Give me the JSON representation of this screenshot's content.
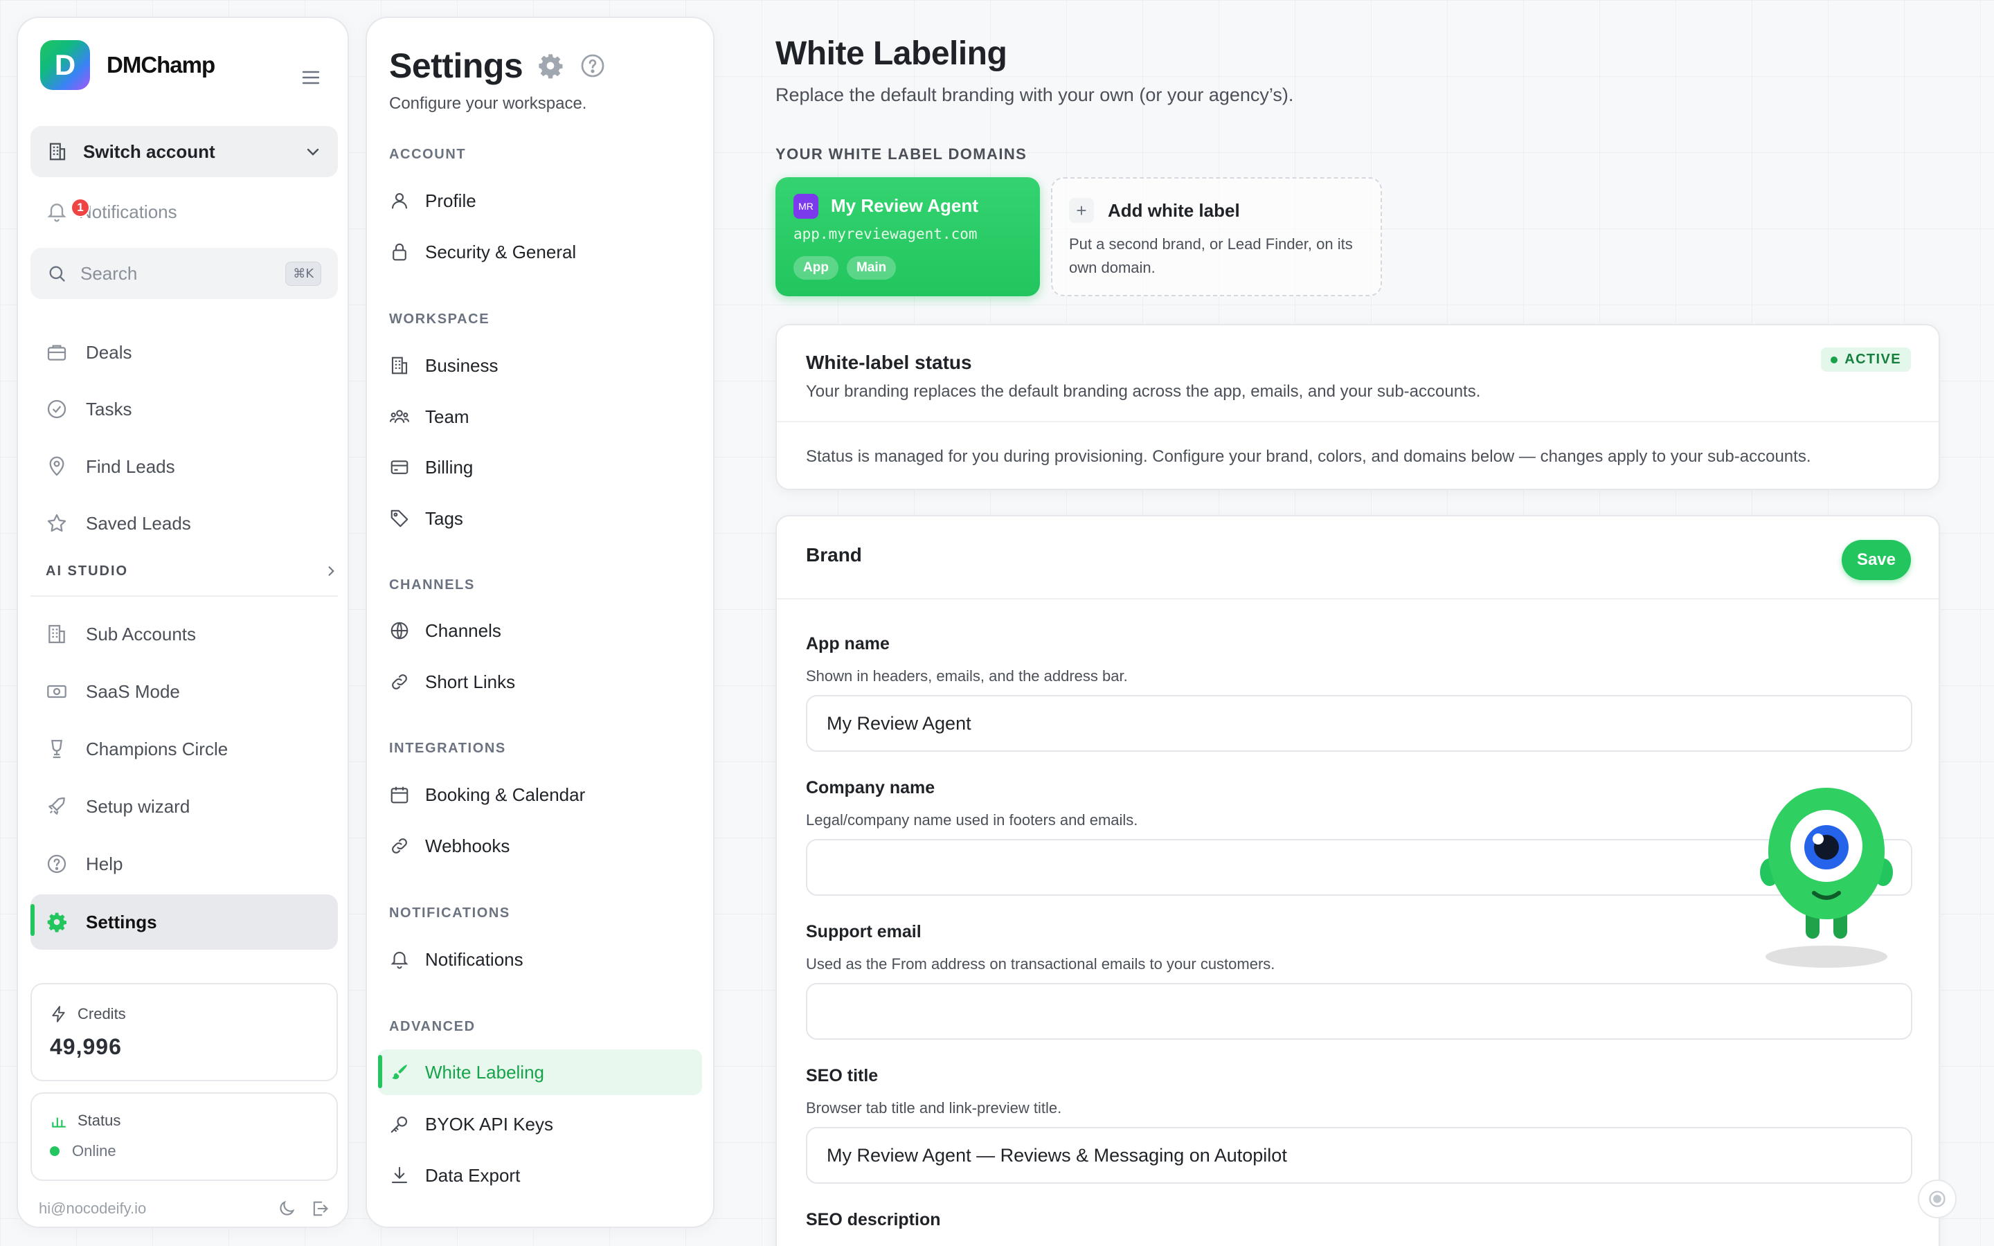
{
  "sidebar": {
    "brand_name": "DMChamp",
    "logo_letter": "D",
    "switch_account": "Switch account",
    "notifications": {
      "label": "Notifications",
      "count": "1"
    },
    "search": {
      "placeholder": "Search",
      "shortcut": "⌘K"
    },
    "items": [
      {
        "label": "Deals",
        "icon": "briefcase-icon"
      },
      {
        "label": "Tasks",
        "icon": "check-circle-icon"
      },
      {
        "label": "Find Leads",
        "icon": "map-pin-icon"
      },
      {
        "label": "Saved Leads",
        "icon": "star-icon"
      }
    ],
    "section": "AI STUDIO",
    "items2": [
      {
        "label": "Sub Accounts",
        "icon": "building-icon"
      },
      {
        "label": "SaaS Mode",
        "icon": "money-icon"
      },
      {
        "label": "Champions Circle",
        "icon": "trophy-icon"
      },
      {
        "label": "Setup wizard",
        "icon": "rocket-icon"
      },
      {
        "label": "Help",
        "icon": "help-icon"
      },
      {
        "label": "Settings",
        "icon": "gear-icon",
        "active": true
      }
    ],
    "credits": {
      "label": "Credits",
      "value": "49,996"
    },
    "status": {
      "label": "Status",
      "value": "Online"
    },
    "user_email": "hi@nocodeify.io"
  },
  "settings": {
    "title": "Settings",
    "subtitle": "Configure your workspace.",
    "groups": [
      {
        "name": "ACCOUNT",
        "items": [
          "Profile",
          "Security & General"
        ]
      },
      {
        "name": "WORKSPACE",
        "items": [
          "Business",
          "Team",
          "Billing",
          "Tags"
        ]
      },
      {
        "name": "CHANNELS",
        "items": [
          "Channels",
          "Short Links"
        ]
      },
      {
        "name": "INTEGRATIONS",
        "items": [
          "Booking & Calendar",
          "Webhooks"
        ]
      },
      {
        "name": "NOTIFICATIONS",
        "items": [
          "Notifications"
        ]
      },
      {
        "name": "ADVANCED",
        "items": [
          "White Labeling",
          "BYOK API Keys",
          "Data Export"
        ]
      }
    ],
    "active_item": "White Labeling"
  },
  "main": {
    "title": "White Labeling",
    "subtitle": "Replace the default branding with your own (or your agency’s).",
    "domains_label": "YOUR WHITE LABEL DOMAINS",
    "domain_card": {
      "avatar": "MR",
      "name": "My Review Agent",
      "url": "app.myreviewagent.com",
      "tags": [
        "App",
        "Main"
      ]
    },
    "add_card": {
      "title": "Add white label",
      "desc": "Put a second brand, or Lead Finder, on its own domain."
    },
    "status_panel": {
      "title": "White-label status",
      "badge": "ACTIVE",
      "desc": "Your branding replaces the default branding across the app, emails, and your sub-accounts.",
      "note": "Status is managed for you during provisioning. Configure your brand, colors, and domains below — changes apply to your sub-accounts."
    },
    "brand_panel": {
      "title": "Brand",
      "save": "Save",
      "fields": {
        "app_name": {
          "label": "App name",
          "help": "Shown in headers, emails, and the address bar.",
          "value": "My Review Agent"
        },
        "company_name": {
          "label": "Company name",
          "help": "Legal/company name used in footers and emails.",
          "value": ""
        },
        "support_email": {
          "label": "Support email",
          "help": "Used as the From address on transactional emails to your customers.",
          "value": ""
        },
        "seo_title": {
          "label": "SEO title",
          "help": "Browser tab title and link-preview title.",
          "value": "My Review Agent — Reviews & Messaging on Autopilot"
        },
        "seo_description": {
          "label": "SEO description"
        }
      }
    }
  },
  "colors": {
    "accent": "#22c55e",
    "badge_red": "#ef4444",
    "avatar_purple": "#7c3aed"
  }
}
